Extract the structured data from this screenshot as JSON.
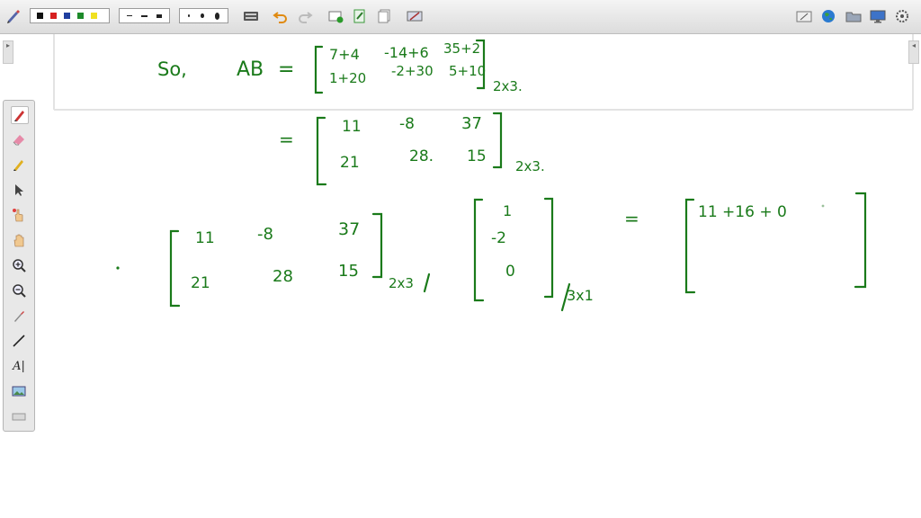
{
  "toolbar": {
    "colors": [
      "#111111",
      "#d62020",
      "#1f3f9f",
      "#1d8a2a",
      "#f0e020"
    ],
    "line_styles": [
      "thin-dash",
      "medium-dash",
      "thick-dash"
    ],
    "line_widths": [
      "small-dot",
      "medium-dot",
      "large-dot"
    ]
  },
  "side_tools": [
    "pen",
    "eraser",
    "highlighter",
    "pointer",
    "laser-hand",
    "pan-hand",
    "zoom-in",
    "zoom-out",
    "eyedropper",
    "line",
    "text",
    "image",
    "shape"
  ],
  "side_tools_text_label": "A|",
  "notes": {
    "so": "So,",
    "ab": "AB",
    "eq": "=",
    "r1": [
      "7+4",
      "-14+6",
      "35+2"
    ],
    "r2": [
      "1+20",
      "-2+30",
      "5+10"
    ],
    "dim1": "2x3.",
    "r3": [
      "11",
      "-8",
      "37"
    ],
    "r4": [
      "21",
      "28.",
      "15"
    ],
    "dim2": "2x3.",
    "m1": [
      "11",
      "-8",
      "37"
    ],
    "m2": [
      "21",
      "28",
      "15"
    ],
    "dim3": "2x3",
    "v": [
      "1",
      "-2",
      "0"
    ],
    "dim4": "3x1",
    "result": "11 +16 + 0"
  },
  "ink_color": "#1a7a1a"
}
